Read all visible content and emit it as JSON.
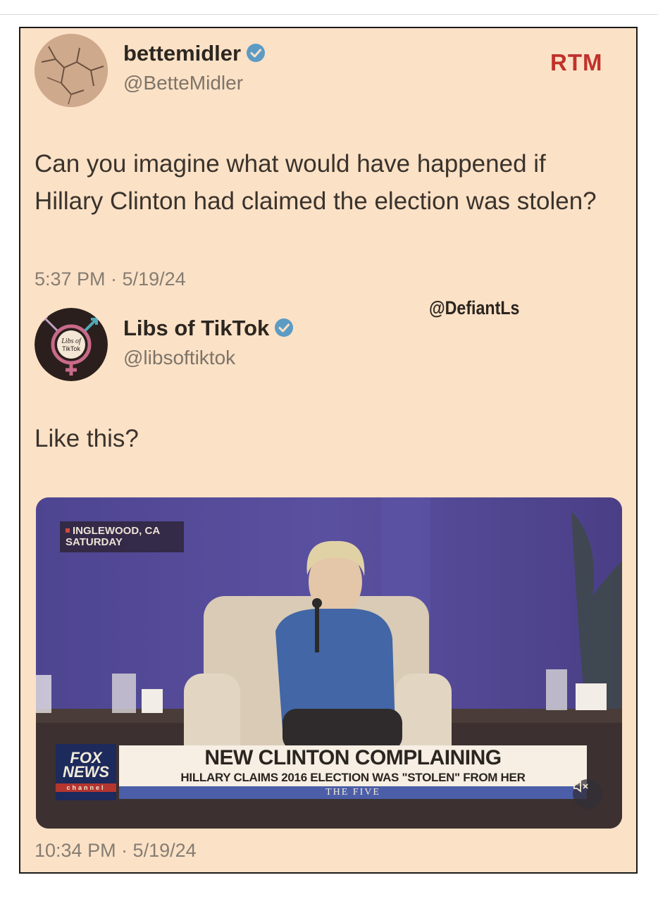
{
  "tweet1": {
    "display_name": "bettemidler",
    "handle": "@BetteMidler",
    "text": "Can you imagine what would have happened if Hillary Clinton had claimed the election was stolen?",
    "timestamp": "5:37 PM · 5/19/24"
  },
  "badge": "RTM",
  "watermark": "@DefiantLs",
  "tweet2": {
    "display_name": "Libs of TikTok",
    "handle": "@libsoftiktok",
    "avatar_text": "Libs of TikTok",
    "text": "Like this?",
    "timestamp": "10:34 PM · 5/19/24"
  },
  "video": {
    "location_line1": "INGLEWOOD, CA",
    "location_line2": "SATURDAY",
    "headline": "NEW CLINTON COMPLAINING",
    "subheadline": "HILLARY CLAIMS 2016 ELECTION WAS \"STOLEN\" FROM HER",
    "show_name": "THE FIVE",
    "network_logo_line1": "FOX",
    "network_logo_line2": "NEWS",
    "network_logo_line3": "channel"
  },
  "icons": {
    "verified": "verified-badge-icon",
    "mute": "speaker-muted-icon"
  },
  "colors": {
    "card_bg": "#fbe1c6",
    "badge_red": "#c0312a",
    "verified_blue": "#5b9bc4"
  }
}
